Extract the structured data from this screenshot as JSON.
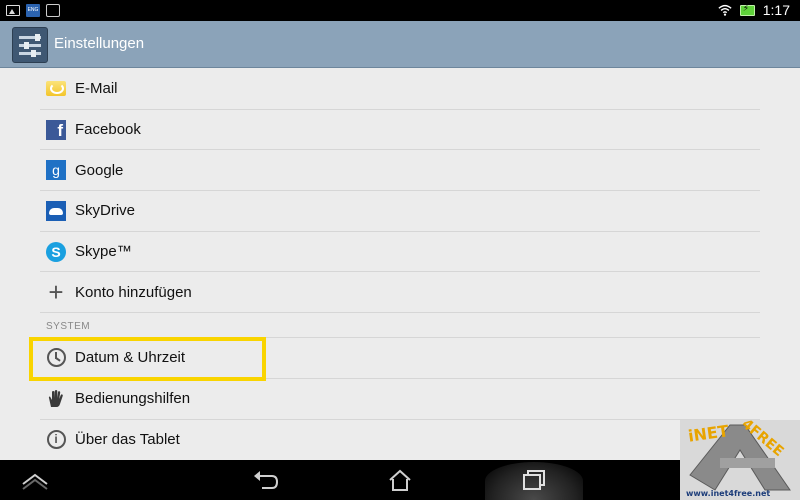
{
  "status_bar": {
    "left_icons": [
      "gallery-icon",
      "app-icon",
      "notification-icon"
    ],
    "app_icon_text": "ENG",
    "clock": "1:17",
    "right_icons": [
      "wifi-icon",
      "battery-charging-icon"
    ]
  },
  "action_bar": {
    "title": "Einstellungen",
    "icon": "settings-sliders-icon",
    "background": "#8ba3b9"
  },
  "accounts": [
    {
      "label": "E-Mail",
      "icon": "email-icon"
    },
    {
      "label": "Facebook",
      "icon": "facebook-icon"
    },
    {
      "label": "Google",
      "icon": "google-icon"
    },
    {
      "label": "SkyDrive",
      "icon": "skydrive-icon"
    },
    {
      "label": "Skype™",
      "icon": "skype-icon"
    },
    {
      "label": "Konto hinzufügen",
      "icon": "plus-icon"
    }
  ],
  "system": {
    "header": "SYSTEM",
    "items": [
      {
        "label": "Datum & Uhrzeit",
        "icon": "clock-icon"
      },
      {
        "label": "Bedienungshilfen",
        "icon": "hand-icon"
      },
      {
        "label": "Über das Tablet",
        "icon": "info-icon"
      }
    ]
  },
  "highlight_color": "#f9d400",
  "nav_bar": {
    "buttons": [
      "up-chevron-icon",
      "back-icon",
      "home-icon",
      "recent-apps-icon"
    ]
  },
  "watermark": {
    "line1": "iNET",
    "line2": "4FREE",
    "url": "www.inet4free.net"
  }
}
